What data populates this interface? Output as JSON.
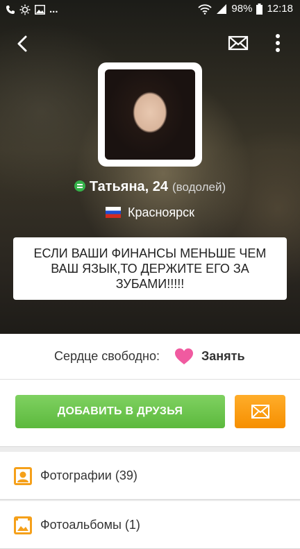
{
  "status_bar": {
    "ellipsis": "...",
    "battery": "98%",
    "time": "12:18"
  },
  "profile": {
    "name": "Татьяна, 24",
    "zodiac": "(водолей)",
    "city": "Красноярск",
    "status_text": "ЕСЛИ ВАШИ ФИНАНСЫ МЕНЬШЕ ЧЕМ ВАШ ЯЗЫК,ТО ДЕРЖИТЕ ЕГО ЗА ЗУБАМИ!!!!!"
  },
  "heart": {
    "label": "Сердце свободно:",
    "action": "Занять"
  },
  "actions": {
    "add_friend": "ДОБАВИТЬ В ДРУЗЬЯ"
  },
  "menu": [
    {
      "label": "Фотографии (39)",
      "icon": "photo-portrait-icon"
    },
    {
      "label": "Фотоальбомы (1)",
      "icon": "photo-album-icon"
    }
  ],
  "colors": {
    "online": "#35b24a",
    "add_button": "#5cb93d",
    "message_button": "#f68f00",
    "heart": "#f05aa0",
    "menu_icon": "#f5a01a"
  }
}
